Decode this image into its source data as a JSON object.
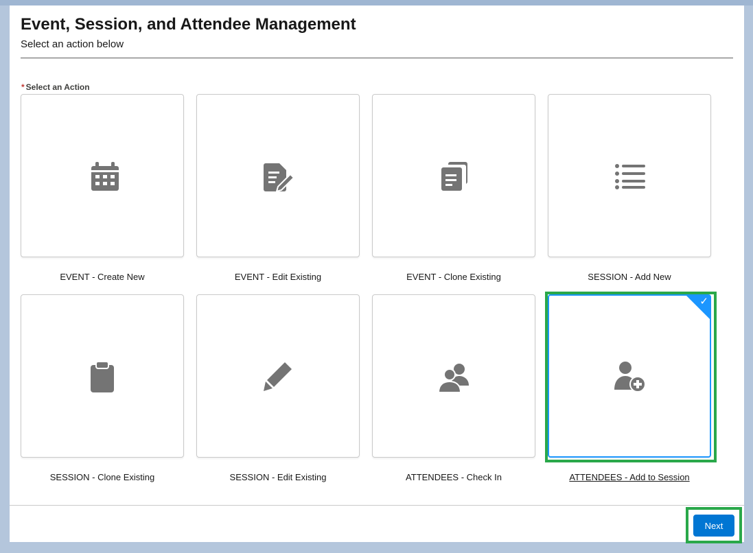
{
  "header": {
    "title": "Event, Session, and Attendee Management",
    "subtitle": "Select an action below"
  },
  "field": {
    "required_marker": "*",
    "label": "Select an Action"
  },
  "tiles": [
    {
      "label": "EVENT - Create New",
      "icon": "calendar-icon",
      "selected": false
    },
    {
      "label": "EVENT - Edit Existing",
      "icon": "edit-document-icon",
      "selected": false
    },
    {
      "label": "EVENT - Clone Existing",
      "icon": "copy-document-icon",
      "selected": false
    },
    {
      "label": "SESSION - Add New",
      "icon": "list-icon",
      "selected": false
    },
    {
      "label": "SESSION - Clone Existing",
      "icon": "clipboard-icon",
      "selected": false
    },
    {
      "label": "SESSION - Edit Existing",
      "icon": "pencil-icon",
      "selected": false
    },
    {
      "label": "ATTENDEES - Check In",
      "icon": "people-icon",
      "selected": false
    },
    {
      "label": "ATTENDEES - Add to Session",
      "icon": "add-user-icon",
      "selected": true
    }
  ],
  "footer": {
    "next_label": "Next"
  },
  "colors": {
    "brand": "#0176d3",
    "selected_border": "#1b96ff",
    "highlight": "#2aa84a",
    "icon": "#747474"
  }
}
